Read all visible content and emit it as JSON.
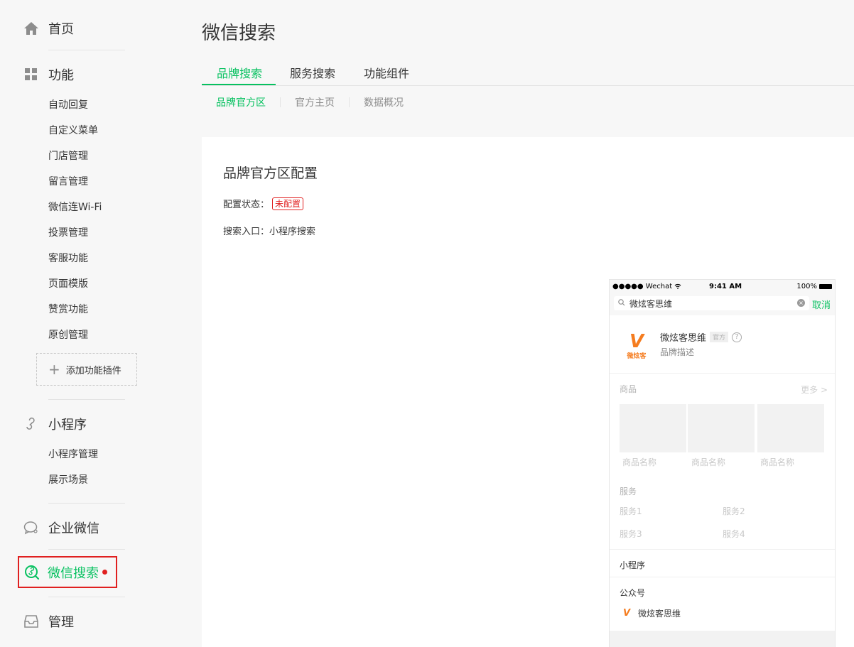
{
  "sidebar": {
    "home": "首页",
    "features": "功能",
    "feature_items": [
      "自动回复",
      "自定义菜单",
      "门店管理",
      "留言管理",
      "微信连Wi-Fi",
      "投票管理",
      "客服功能",
      "页面模版",
      "赞赏功能",
      "原创管理"
    ],
    "add_plugin": "添加功能插件",
    "mini_program": "小程序",
    "mini_items": [
      "小程序管理",
      "展示场景"
    ],
    "work_wechat": "企业微信",
    "wechat_search": "微信搜索",
    "manage": "管理"
  },
  "header": {
    "title": "微信搜索",
    "tabs": [
      "品牌搜索",
      "服务搜索",
      "功能组件"
    ],
    "subtabs": [
      "品牌官方区",
      "官方主页",
      "数据概况"
    ]
  },
  "panel": {
    "title": "品牌官方区配置",
    "status_label": "配置状态：",
    "status_value": "未配置",
    "entry_label": "搜索入口：",
    "entry_value": "小程序搜索"
  },
  "phone": {
    "carrier": "●●●●● Wechat",
    "time": "9:41 AM",
    "battery": "100%",
    "search_text": "微炫客思维",
    "cancel": "取消",
    "logo_text": "微炫客",
    "brand_name": "微炫客思维",
    "official_tag": "官方",
    "brand_desc": "品牌描述",
    "goods_title": "商品",
    "more": "更多 >",
    "goods_names": [
      "商品名称",
      "商品名称",
      "商品名称"
    ],
    "service_title": "服务",
    "services": [
      "服务1",
      "服务2",
      "服务3",
      "服务4"
    ],
    "mini_program": "小程序",
    "official_account": "公众号",
    "account_name": "微炫客思维"
  },
  "colors": {
    "accent": "#07c160",
    "alert": "#e02020",
    "brand_orange": "#f57c1f"
  }
}
